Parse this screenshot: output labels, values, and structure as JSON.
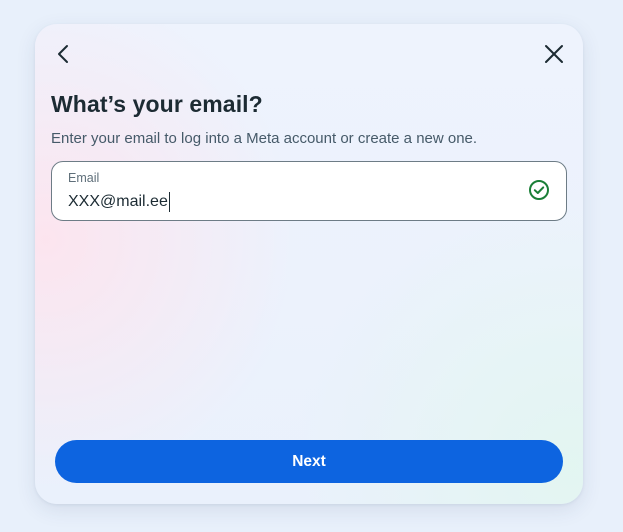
{
  "header": {
    "back_icon": "chevron-left-icon",
    "close_icon": "close-icon"
  },
  "content": {
    "title": "What’s your email?",
    "subtitle": "Enter your email to log into a Meta account or create a new one."
  },
  "email_field": {
    "label": "Email",
    "value": "XXX@mail.ee",
    "status_icon": "check-circle-icon",
    "status_color": "#1a7f37"
  },
  "footer": {
    "next_label": "Next",
    "accent_color": "#0d64e0"
  }
}
